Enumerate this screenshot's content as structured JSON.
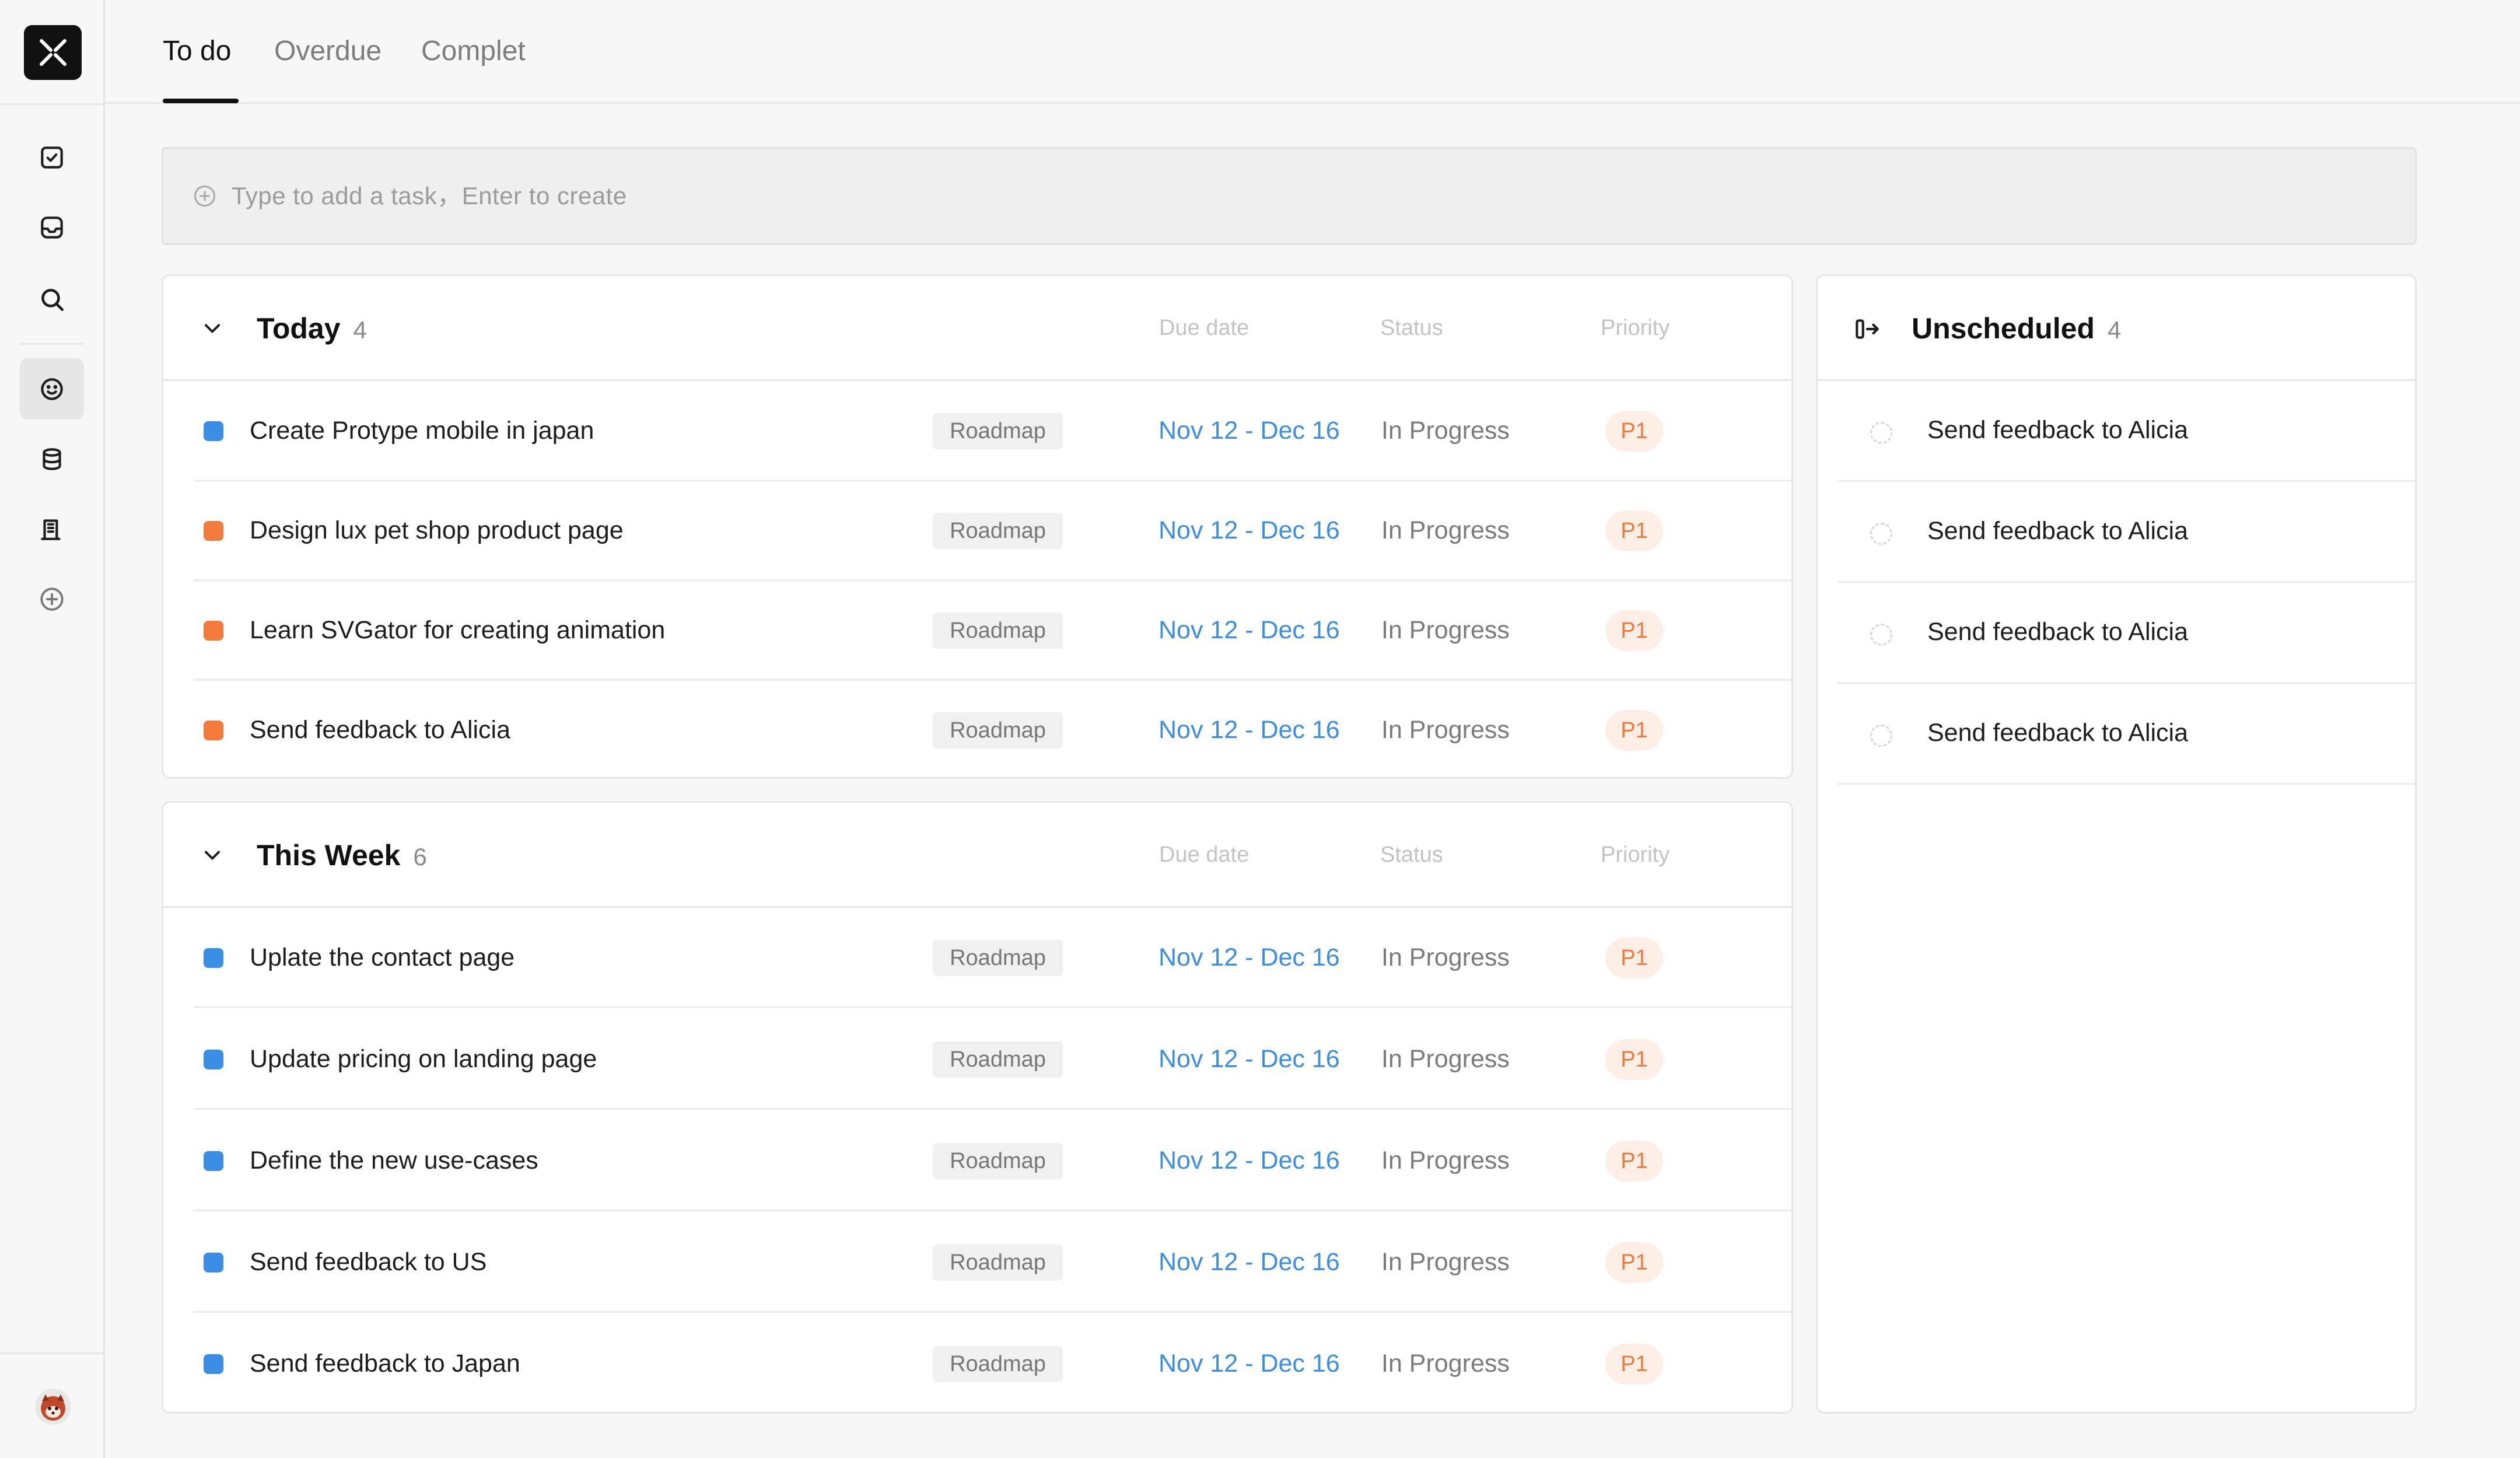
{
  "tabs": [
    {
      "label": "To do",
      "active": true
    },
    {
      "label": "Overdue",
      "active": false
    },
    {
      "label": "Complet",
      "active": false
    }
  ],
  "sidebar": {
    "items": [
      {
        "icon": "checkbox-icon"
      },
      {
        "icon": "inbox-icon"
      },
      {
        "icon": "search-icon"
      },
      {
        "icon": "smiley-icon",
        "active": true
      },
      {
        "icon": "database-icon"
      },
      {
        "icon": "building-icon"
      },
      {
        "icon": "plus-circle-icon"
      }
    ]
  },
  "add_task": {
    "placeholder": "Type to add a task，Enter to create"
  },
  "columns": {
    "due": "Due date",
    "status": "Status",
    "priority": "Priority"
  },
  "sections": [
    {
      "title": "Today",
      "count": "4",
      "rows": [
        {
          "name": "Create Protype mobile in japan",
          "tag": "Roadmap",
          "date": "Nov 12 - Dec 16",
          "status": "In Progress",
          "priority": "P1",
          "color": "#3a8ee6"
        },
        {
          "name": "Design lux pet shop product page",
          "tag": "Roadmap",
          "date": "Nov 12 - Dec 16",
          "status": "In Progress",
          "priority": "P1",
          "color": "#f47b3b"
        },
        {
          "name": "Learn SVGator for creating animation",
          "tag": "Roadmap",
          "date": "Nov 12 - Dec 16",
          "status": "In Progress",
          "priority": "P1",
          "color": "#f47b3b"
        },
        {
          "name": "Send feedback to Alicia",
          "tag": "Roadmap",
          "date": "Nov 12 - Dec 16",
          "status": "In Progress",
          "priority": "P1",
          "color": "#f47b3b"
        }
      ]
    },
    {
      "title": "This Week",
      "count": "6",
      "rows": [
        {
          "name": "Uplate the contact page",
          "tag": "Roadmap",
          "date": "Nov 12 - Dec 16",
          "status": "In Progress",
          "priority": "P1",
          "color": "#3a8ee6"
        },
        {
          "name": "Update pricing on landing page",
          "tag": "Roadmap",
          "date": "Nov 12 - Dec 16",
          "status": "In Progress",
          "priority": "P1",
          "color": "#3a8ee6"
        },
        {
          "name": "Define the new use-cases",
          "tag": "Roadmap",
          "date": "Nov 12 - Dec 16",
          "status": "In Progress",
          "priority": "P1",
          "color": "#3a8ee6"
        },
        {
          "name": "Send feedback to US",
          "tag": "Roadmap",
          "date": "Nov 12 - Dec 16",
          "status": "In Progress",
          "priority": "P1",
          "color": "#3a8ee6"
        },
        {
          "name": "Send feedback to Japan",
          "tag": "Roadmap",
          "date": "Nov 12 - Dec 16",
          "status": "In Progress",
          "priority": "P1",
          "color": "#3a8ee6"
        }
      ]
    }
  ],
  "unscheduled": {
    "title": "Unscheduled",
    "count": "4",
    "items": [
      {
        "name": "Send feedback to Alicia"
      },
      {
        "name": "Send feedback to Alicia"
      },
      {
        "name": "Send feedback to Alicia"
      },
      {
        "name": "Send feedback to Alicia"
      }
    ]
  }
}
